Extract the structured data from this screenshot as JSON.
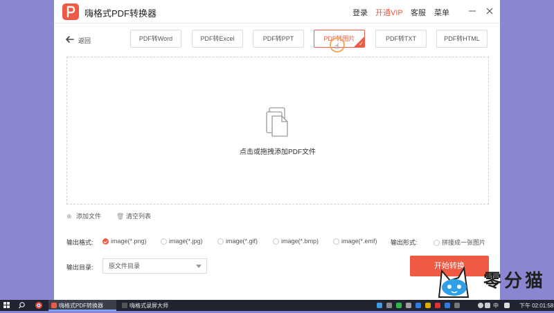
{
  "app": {
    "title": "嗨格式PDF转换器",
    "nav": {
      "login": "登录",
      "vip": "开通VIP",
      "support": "客服",
      "menu": "菜单"
    },
    "back_label": "返回"
  },
  "tabs": [
    {
      "label": "PDF转Word",
      "active": false
    },
    {
      "label": "PDF转Excel",
      "active": false
    },
    {
      "label": "PDF转PPT",
      "active": false
    },
    {
      "label": "PDF转图片",
      "active": true
    },
    {
      "label": "PDF转TXT",
      "active": false
    },
    {
      "label": "PDF转HTML",
      "active": false
    }
  ],
  "dropzone": {
    "text": "点击或拖拽添加PDF文件",
    "icon": "files-icon"
  },
  "file_actions": {
    "add": "添加文件",
    "clear": "清空列表"
  },
  "output_format": {
    "label": "输出格式:",
    "options": [
      {
        "label": "image(*.png)",
        "selected": true
      },
      {
        "label": "image(*.jpg)",
        "selected": false
      },
      {
        "label": "image(*.gif)",
        "selected": false
      },
      {
        "label": "image(*.bmp)",
        "selected": false
      },
      {
        "label": "image(*.emf)",
        "selected": false
      }
    ]
  },
  "output_form": {
    "label": "输出形式:",
    "option": "拼接成一张图片",
    "selected": false
  },
  "output_dir": {
    "label": "输出目录:",
    "value": "原文件目录"
  },
  "start_button": "开始转换",
  "watermark": "零分猫",
  "taskbar": {
    "apps": [
      "嗨格式PDF转换器",
      "嗨格式录屏大师"
    ],
    "ime": "中",
    "clock": "下午 02:01:58"
  },
  "colors": {
    "accent": "#ef5a45",
    "desktop": "#8a86d2",
    "taskbar": "#1f2430"
  }
}
